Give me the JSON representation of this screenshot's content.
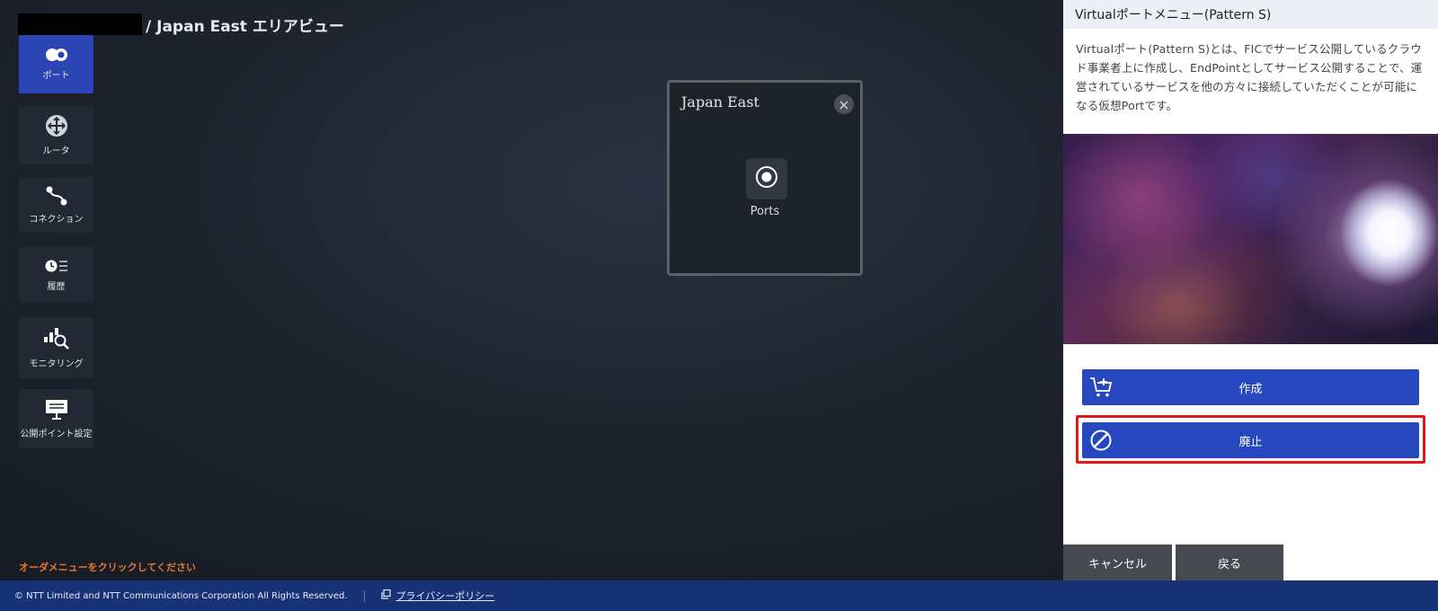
{
  "header": {
    "title": "/ Japan East エリアビュー"
  },
  "sidebar": {
    "items": [
      {
        "label": "ポート",
        "icon": "port-icon"
      },
      {
        "label": "ルータ",
        "icon": "router-icon"
      },
      {
        "label": "コネクション",
        "icon": "connection-icon"
      },
      {
        "label": "履歴",
        "icon": "history-icon"
      },
      {
        "label": "モニタリング",
        "icon": "monitoring-icon"
      },
      {
        "label": "公開ポイント設定",
        "icon": "public-point-icon"
      }
    ]
  },
  "popup": {
    "title": "Japan East",
    "ports_label": "Ports"
  },
  "panel": {
    "title": "Virtualポートメニュー(Pattern S)",
    "description": "Virtualポート(Pattern S)とは、FICでサービス公開しているクラウド事業者上に作成し、EndPointとしてサービス公開することで、運営されているサービスを他の方々に接続していただくことが可能になる仮想Portです。",
    "create_label": "作成",
    "abolish_label": "廃止"
  },
  "actions": {
    "cancel_label": "キャンセル",
    "back_label": "戻る"
  },
  "order_message": "オーダメニューをクリックしてください",
  "footer": {
    "copyright": "© NTT Limited and NTT Communications Corporation All Rights Reserved.",
    "privacy_label": "プライバシーポリシー"
  },
  "colors": {
    "accent": "#2747be",
    "active_nav": "#2b45b4",
    "footer": "#173276",
    "highlight": "#e3181d",
    "order_message": "#e0782e"
  }
}
